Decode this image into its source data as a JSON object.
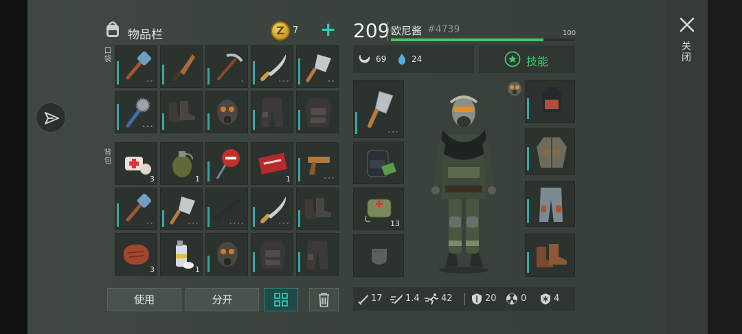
{
  "inventory": {
    "title": "物品栏",
    "coins": "7",
    "plus": "+",
    "pocket_label": "口袋",
    "backpack_label": "背包",
    "pocket_slots": [
      {
        "item": "sledgehammer",
        "count": "",
        "durability": 0.7,
        "dots": "••",
        "dotcolor": "#6a736c"
      },
      {
        "item": "machete-rusty",
        "count": "",
        "durability": 0.6,
        "dots": "",
        "dotcolor": ""
      },
      {
        "item": "pickaxe",
        "count": "",
        "durability": 0.5,
        "dots": "•",
        "dotcolor": "#6a736c"
      },
      {
        "item": "machete",
        "count": "",
        "durability": 0.7,
        "dots": "•••",
        "dotcolor": "#6a736c"
      },
      {
        "item": "cleaver",
        "count": "",
        "durability": 0.8,
        "dots": "••",
        "dotcolor": "#3b8fd1"
      },
      {
        "item": "saw-club",
        "count": "",
        "durability": 0.8,
        "dots": "•••",
        "dotcolor": "#b06ce0"
      },
      {
        "item": "boots",
        "count": "",
        "durability": 0.5,
        "dots": "",
        "dotcolor": ""
      },
      {
        "item": "gas-mask",
        "count": "",
        "durability": 0.5,
        "dots": "",
        "dotcolor": ""
      },
      {
        "item": "pants",
        "count": "",
        "durability": 0.6,
        "dots": "",
        "dotcolor": ""
      },
      {
        "item": "armor-vest",
        "count": "",
        "durability": 0.6,
        "dots": "",
        "dotcolor": ""
      }
    ],
    "backpack_slots": [
      {
        "item": "bandage",
        "count": "3",
        "durability": 0,
        "dots": "",
        "dotcolor": ""
      },
      {
        "item": "grenade",
        "count": "1",
        "durability": 0,
        "dots": "",
        "dotcolor": ""
      },
      {
        "item": "stop-sign",
        "count": "",
        "durability": 0.6,
        "dots": "",
        "dotcolor": ""
      },
      {
        "item": "coupon",
        "count": "1",
        "durability": 0,
        "dots": "",
        "dotcolor": ""
      },
      {
        "item": "flare-gun",
        "count": "",
        "durability": 0.7,
        "dots": "•••",
        "dotcolor": "#6a736c"
      },
      {
        "item": "sledgehammer",
        "count": "",
        "durability": 0.7,
        "dots": "••",
        "dotcolor": "#6a736c"
      },
      {
        "item": "cleaver",
        "count": "",
        "durability": 0.5,
        "dots": "•••",
        "dotcolor": "#6a736c"
      },
      {
        "item": "rifle",
        "count": "",
        "durability": 0.6,
        "dots": "••••",
        "dotcolor": "#6a736c"
      },
      {
        "item": "machete",
        "count": "",
        "durability": 0.6,
        "dots": "•••",
        "dotcolor": "#6a736c"
      },
      {
        "item": "boots",
        "count": "",
        "durability": 0.5,
        "dots": "",
        "dotcolor": ""
      },
      {
        "item": "steak",
        "count": "3",
        "durability": 0,
        "dots": "",
        "dotcolor": ""
      },
      {
        "item": "spray-can",
        "count": "1",
        "durability": 0,
        "dots": "",
        "dotcolor": ""
      },
      {
        "item": "gas-mask",
        "count": "",
        "durability": 0.5,
        "dots": "",
        "dotcolor": ""
      },
      {
        "item": "armor-vest",
        "count": "",
        "durability": 0.6,
        "dots": "",
        "dotcolor": ""
      },
      {
        "item": "pants",
        "count": "",
        "durability": 0.6,
        "dots": "",
        "dotcolor": ""
      }
    ],
    "use_label": "使用",
    "split_label": "分开"
  },
  "player": {
    "level": "209",
    "name": "欧尼酱",
    "tag": "#4739",
    "xp_max": "100",
    "xp_fraction": 0.83,
    "food": "69",
    "water": "24",
    "skills_label": "技能",
    "backpack_count": "13"
  },
  "stats": {
    "damage": "17",
    "attack_speed": "1.4",
    "speed": "42",
    "armor": "20",
    "radiation": "0",
    "cold": "4"
  },
  "close_label": "关闭",
  "colors": {
    "accent": "#35c9b3",
    "xp": "#47c66a",
    "durability": "#3aa6a4"
  }
}
